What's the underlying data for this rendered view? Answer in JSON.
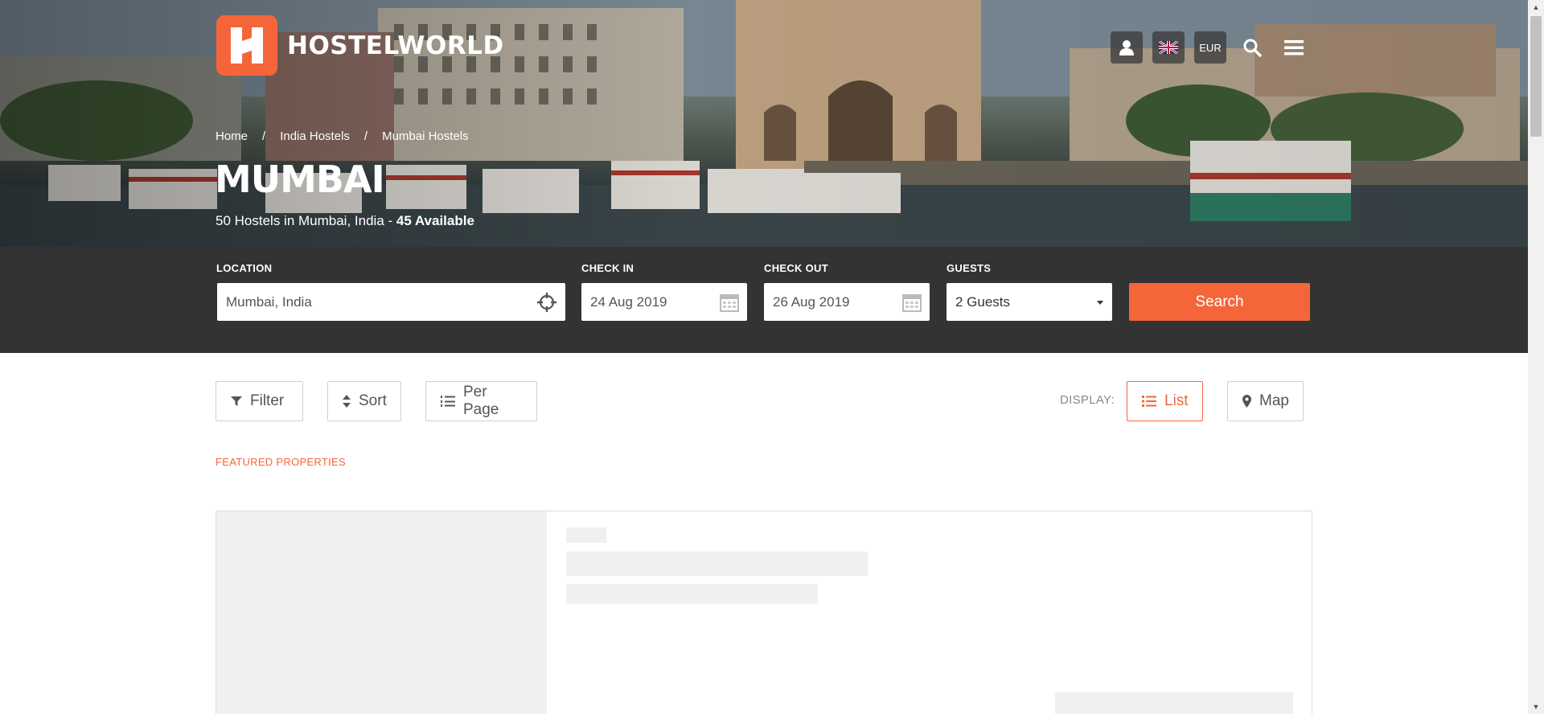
{
  "brand": {
    "name": "HOSTELWORLD",
    "accent": "#f4663a"
  },
  "header": {
    "actions": [
      {
        "name": "account-icon"
      },
      {
        "name": "uk-flag-icon"
      },
      {
        "name": "currency",
        "label": "EUR"
      },
      {
        "name": "search-icon"
      },
      {
        "name": "menu-icon"
      }
    ]
  },
  "breadcrumb": {
    "items": [
      "Home",
      "India Hostels",
      "Mumbai Hostels"
    ],
    "separator": "/"
  },
  "city": {
    "title": "MUMBAI",
    "subtitle": "50 Hostels in Mumbai, India - ",
    "available": "45 Available"
  },
  "search": {
    "location_label": "LOCATION",
    "location_value": "Mumbai, India",
    "checkin_label": "CHECK IN",
    "checkin_value": "24 Aug 2019",
    "checkout_label": "CHECK OUT",
    "checkout_value": "26 Aug 2019",
    "guests_label": "GUESTS",
    "guests_value": "2 Guests",
    "submit_label": "Search"
  },
  "toolbar": {
    "filter_label": "Filter",
    "sort_label": "Sort",
    "perpage_label": "Per Page",
    "display_label": "DISPLAY:",
    "list_label": "List",
    "map_label": "Map"
  },
  "featured": {
    "label": "FEATURED PROPERTIES"
  },
  "colors": {
    "searchbar": "#333333",
    "accent": "#f4663a",
    "skeleton": "#f0f0f0"
  }
}
